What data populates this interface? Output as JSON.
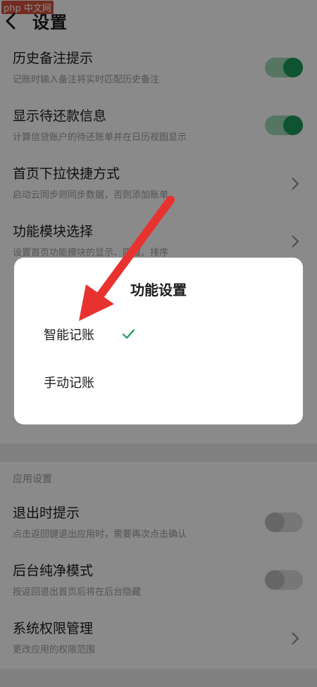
{
  "header": {
    "title": "设置",
    "watermark": "php 中文网"
  },
  "settings": [
    {
      "title": "历史备注提示",
      "subtitle": "记账时输入备注将实时匹配历史备注",
      "control": "toggle",
      "on": true
    },
    {
      "title": "显示待还款信息",
      "subtitle": "计算信贷账户的待还账单并在日历视图显示",
      "control": "toggle",
      "on": true
    },
    {
      "title": "首页下拉快捷方式",
      "subtitle": "启动云同步则同步数据，否则添加账单",
      "control": "chevron"
    },
    {
      "title": "功能模块选择",
      "subtitle": "设置首页功能模块的显示、隐藏、排序",
      "control": "chevron"
    }
  ],
  "app_section": {
    "label": "应用设置",
    "items": [
      {
        "title": "退出时提示",
        "subtitle": "点击返回键退出应用时，需要再次点击确认",
        "control": "toggle",
        "on": false
      },
      {
        "title": "后台纯净模式",
        "subtitle": "按返回退出首页后将在后台隐藏",
        "control": "toggle",
        "on": false
      },
      {
        "title": "系统权限管理",
        "subtitle": "更改应用的权限范围",
        "control": "chevron"
      }
    ]
  },
  "dialog": {
    "title": "功能设置",
    "options": [
      {
        "label": "智能记账",
        "selected": true
      },
      {
        "label": "手动记账",
        "selected": false
      }
    ]
  },
  "colors": {
    "accent": "#1b9b5a",
    "annotation_arrow": "#e8322f"
  }
}
